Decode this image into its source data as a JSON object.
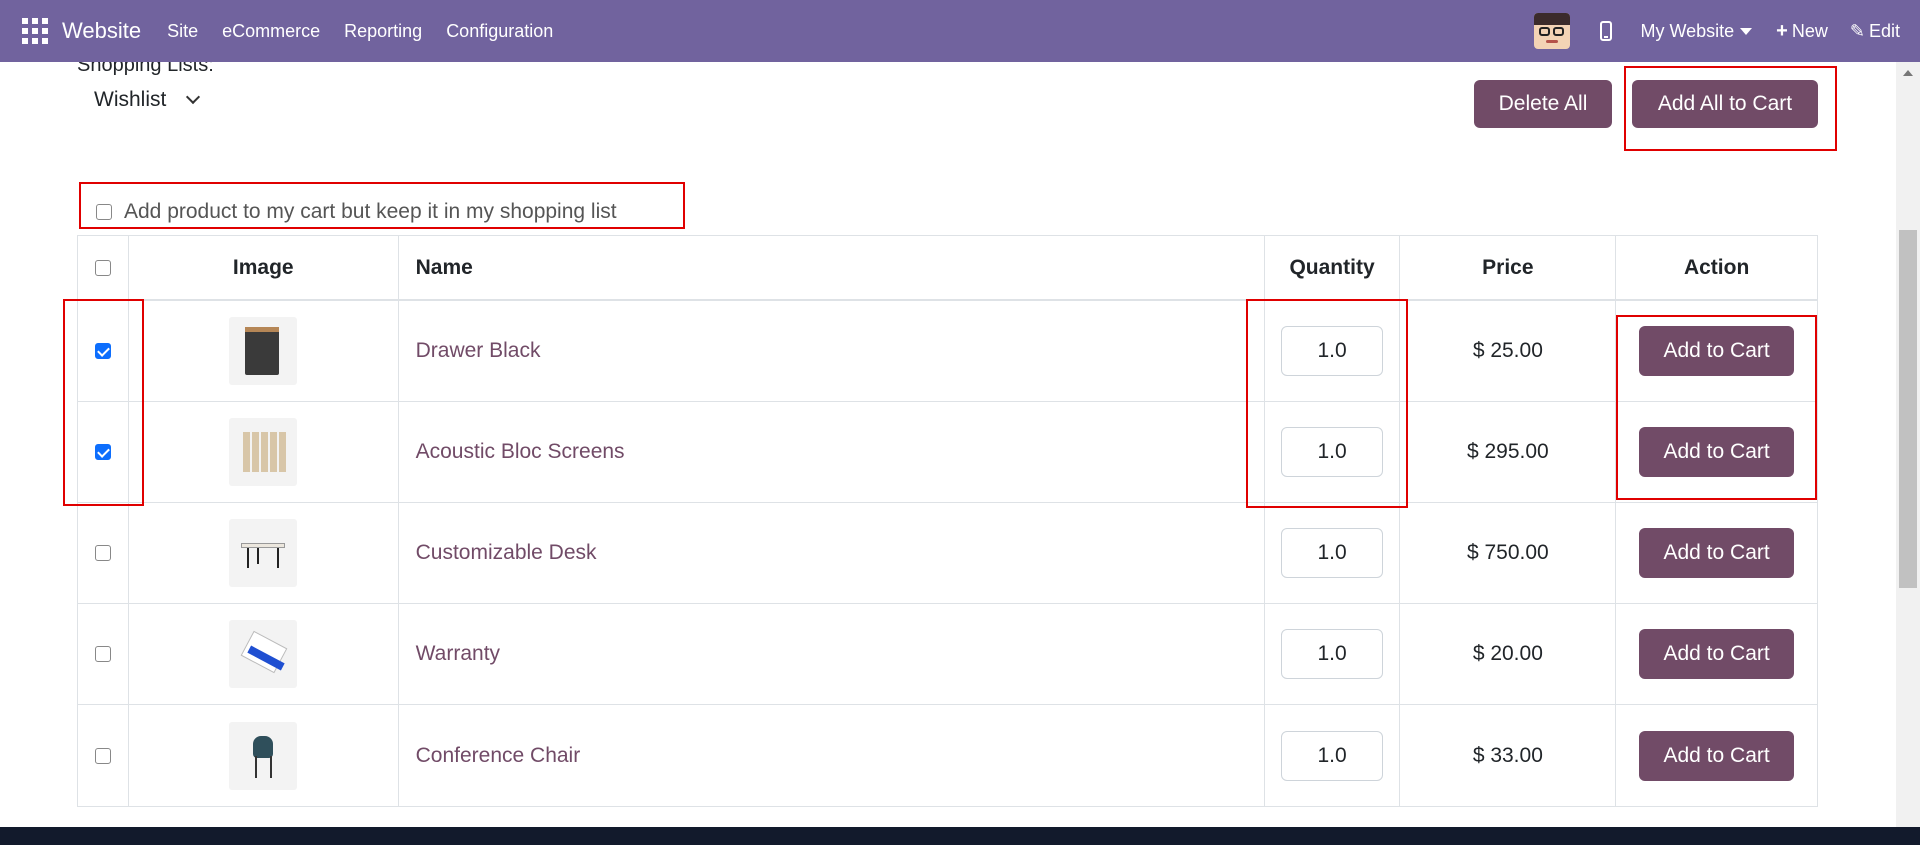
{
  "navbar": {
    "brand": "Website",
    "menu": [
      "Site",
      "eCommerce",
      "Reporting",
      "Configuration"
    ],
    "site_selector": "My Website",
    "new_label": "New",
    "edit_label": "Edit"
  },
  "shopping": {
    "lists_label": "Shopping Lists:",
    "selected_list": "Wishlist",
    "delete_all_label": "Delete All",
    "add_all_label": "Add All to Cart",
    "keep_label": "Add product to my cart but keep it in my shopping list",
    "keep_checked": false
  },
  "table": {
    "headers": {
      "image": "Image",
      "name": "Name",
      "quantity": "Quantity",
      "price": "Price",
      "action": "Action"
    },
    "rows": [
      {
        "checked": true,
        "name": "Drawer Black",
        "quantity": "1.0",
        "price": "$ 25.00",
        "action": "Add to Cart",
        "icon": "drawer-icon"
      },
      {
        "checked": true,
        "name": "Acoustic Bloc Screens",
        "quantity": "1.0",
        "price": "$ 295.00",
        "action": "Add to Cart",
        "icon": "screen-icon"
      },
      {
        "checked": false,
        "name": "Customizable Desk",
        "quantity": "1.0",
        "price": "$ 750.00",
        "action": "Add to Cart",
        "icon": "desk-icon"
      },
      {
        "checked": false,
        "name": "Warranty",
        "quantity": "1.0",
        "price": "$ 20.00",
        "action": "Add to Cart",
        "icon": "warranty-icon"
      },
      {
        "checked": false,
        "name": "Conference Chair",
        "quantity": "1.0",
        "price": "$ 33.00",
        "action": "Add to Cart",
        "icon": "chair-icon"
      }
    ]
  },
  "colors": {
    "navbar": "#71639e",
    "primary_button": "#714b67",
    "annotation": "#e00000",
    "checkbox_checked": "#0d6efd"
  }
}
